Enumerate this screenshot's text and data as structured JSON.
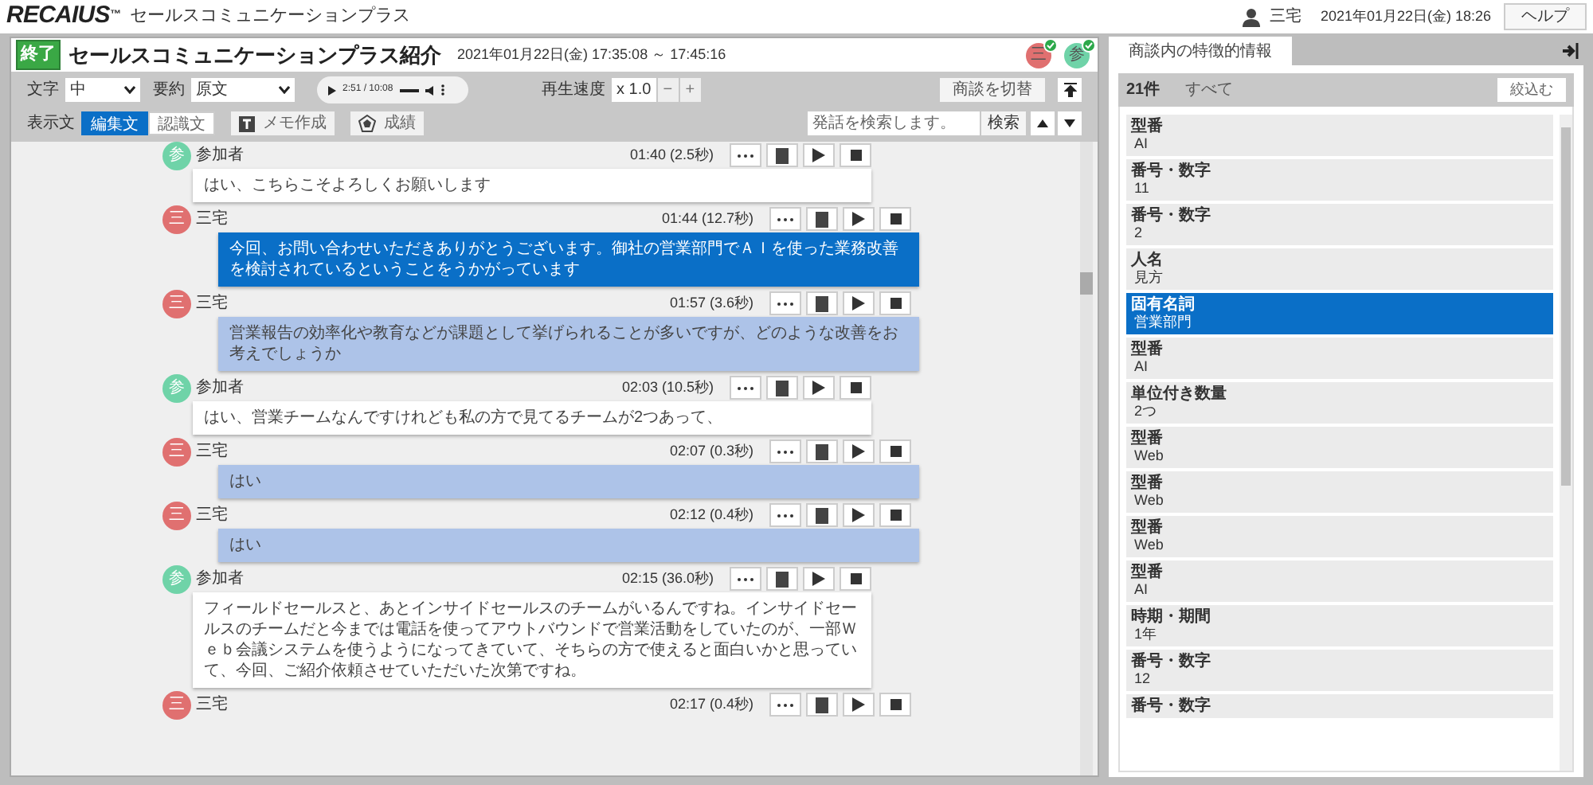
{
  "app_header": {
    "logo": "RECAIUS",
    "logo_mark": "™",
    "product": "セールスコミュニケーションプラス",
    "user": "三宅",
    "datetime": "2021年01月22日(金) 18:26",
    "help": "ヘルプ"
  },
  "session": {
    "status": "終了",
    "title": "セールスコミュニケーションプラス紹介",
    "period": "2021年01月22日(金) 17:35:08 ～ 17:45:16",
    "participants": [
      {
        "label": "三",
        "color": "#e07070",
        "connected": true
      },
      {
        "label": "参",
        "color": "#6fd3a8",
        "connected": true
      }
    ]
  },
  "toolbar": {
    "font_label": "文字",
    "font_value": "中",
    "summary_label": "要約",
    "summary_value": "原文",
    "player_time": "2:51 / 10:08",
    "speed_label": "再生速度",
    "speed_value": "x 1.0",
    "minus": "−",
    "plus": "+",
    "switch_button": "商談を切替",
    "display_label": "表示文",
    "display_options": [
      {
        "label": "編集文",
        "selected": true
      },
      {
        "label": "認識文",
        "selected": false
      }
    ],
    "memo_button": "メモ作成",
    "score_button": "成績",
    "search_placeholder": "発話を検索します。",
    "search_button": "検索"
  },
  "messages": [
    {
      "kind": "customer",
      "avatar": "参",
      "speaker": "参加者",
      "time": "01:40",
      "duration": "(2.5秒)",
      "selected": false,
      "text": "はい、こちらこそよろしくお願いします"
    },
    {
      "kind": "sales",
      "avatar": "三",
      "speaker": "三宅",
      "time": "01:44",
      "duration": "(12.7秒)",
      "selected": true,
      "text": "今回、お問い合わせいただきありがとうございます。御社の営業部門でＡＩを使った業務改善を検討されているということをうかがっています"
    },
    {
      "kind": "sales",
      "avatar": "三",
      "speaker": "三宅",
      "time": "01:57",
      "duration": "(3.6秒)",
      "selected": false,
      "text": "営業報告の効率化や教育などが課題として挙げられることが多いですが、どのような改善をお考えでしょうか"
    },
    {
      "kind": "customer",
      "avatar": "参",
      "speaker": "参加者",
      "time": "02:03",
      "duration": "(10.5秒)",
      "selected": false,
      "text": "はい、営業チームなんですけれども私の方で見てるチームが2つあって、"
    },
    {
      "kind": "sales",
      "avatar": "三",
      "speaker": "三宅",
      "time": "02:07",
      "duration": "(0.3秒)",
      "selected": false,
      "text": "はい"
    },
    {
      "kind": "sales",
      "avatar": "三",
      "speaker": "三宅",
      "time": "02:12",
      "duration": "(0.4秒)",
      "selected": false,
      "text": "はい"
    },
    {
      "kind": "customer",
      "avatar": "参",
      "speaker": "参加者",
      "time": "02:15",
      "duration": "(36.0秒)",
      "selected": false,
      "text": "フィールドセールスと、あとインサイドセールスのチームがいるんですね。インサイドセールスのチームだと今までは電話を使ってアウトバウンドで営業活動をしていたのが、一部Ｗｅｂ会議システムを使うようになってきていて、そちらの方で使えると面白いかと思っていて、今回、ご紹介依頼させていただいた次第ですね。"
    },
    {
      "kind": "sales",
      "avatar": "三",
      "speaker": "三宅",
      "time": "02:17",
      "duration": "(0.4秒)"
    }
  ],
  "side_panel": {
    "tab": "商談内の特徴的情報",
    "count": "21件",
    "filter_label": "すべて",
    "filter_button": "絞込む",
    "items": [
      {
        "category": "型番",
        "value": "AI",
        "selected": false
      },
      {
        "category": "番号・数字",
        "value": "11",
        "selected": false
      },
      {
        "category": "番号・数字",
        "value": "2",
        "selected": false
      },
      {
        "category": "人名",
        "value": "見方",
        "selected": false
      },
      {
        "category": "固有名詞",
        "value": "営業部門",
        "selected": true
      },
      {
        "category": "型番",
        "value": "AI",
        "selected": false
      },
      {
        "category": "単位付き数量",
        "value": "2つ",
        "selected": false
      },
      {
        "category": "型番",
        "value": "Web",
        "selected": false
      },
      {
        "category": "型番",
        "value": "Web",
        "selected": false
      },
      {
        "category": "型番",
        "value": "Web",
        "selected": false
      },
      {
        "category": "型番",
        "value": "AI",
        "selected": false
      },
      {
        "category": "時期・期間",
        "value": "1年",
        "selected": false
      },
      {
        "category": "番号・数字",
        "value": "12",
        "selected": false
      },
      {
        "category": "番号・数字",
        "selected": false
      }
    ]
  }
}
